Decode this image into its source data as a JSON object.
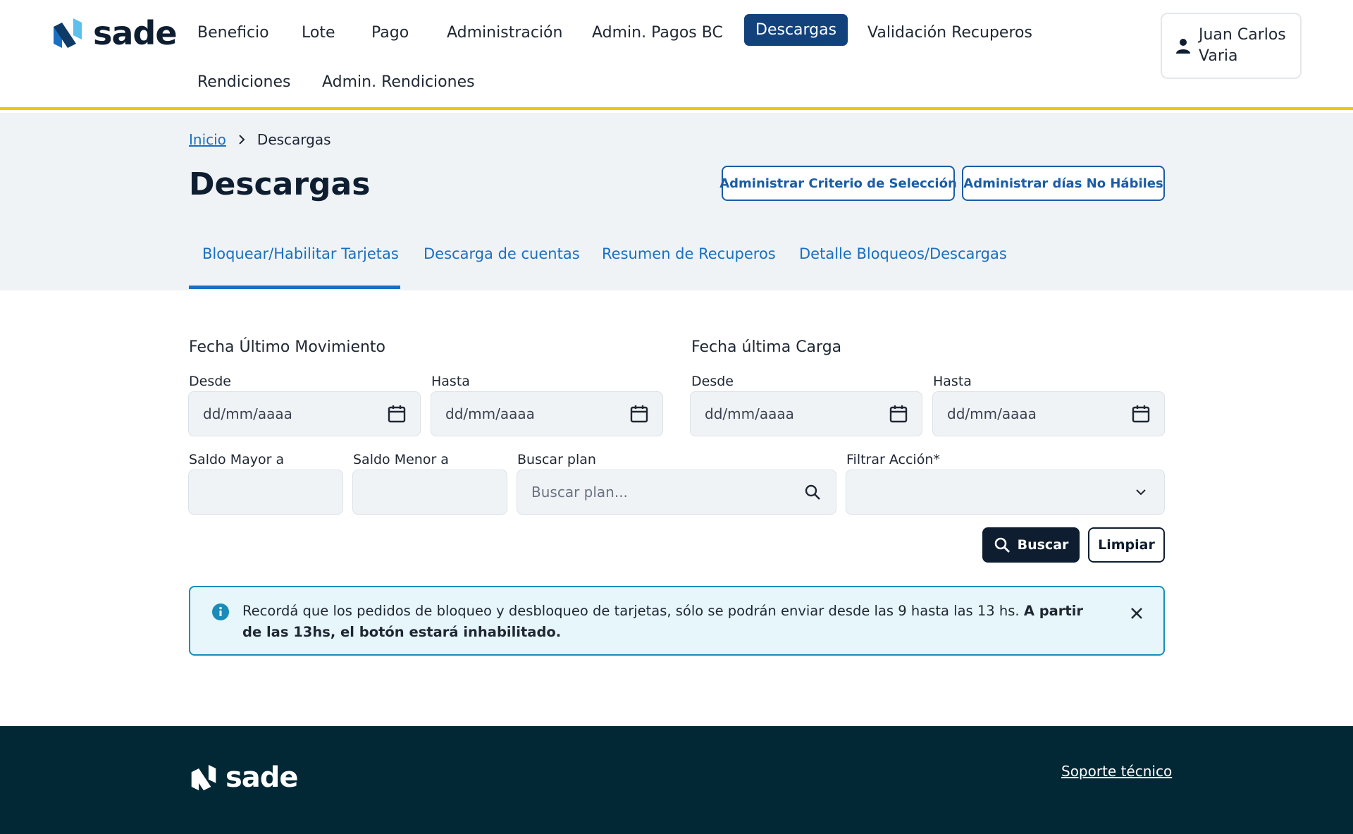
{
  "brand": {
    "name": "sade",
    "accent": "#f6c40c",
    "primary": "#12417b",
    "dark": "#0e1d30"
  },
  "nav": {
    "items": [
      "Beneficio",
      "Lote",
      "Pago",
      "Administración",
      "Admin. Pagos BC",
      "Descargas",
      "Validación Recuperos",
      "Rendiciones",
      "Admin. Rendiciones"
    ],
    "active": "Descargas"
  },
  "user": {
    "name": "Juan Carlos Varia",
    "icon": "person-icon"
  },
  "breadcrumb": {
    "home": "Inicio",
    "separator_icon": "chevron-right-icon",
    "current": "Descargas"
  },
  "page": {
    "title": "Descargas",
    "actions": [
      "Administrar Criterio de Selección",
      "Administrar días No Hábiles"
    ]
  },
  "tabs": {
    "items": [
      "Bloquear/Habilitar Tarjetas",
      "Descarga de cuentas",
      "Resumen de Recuperos",
      "Detalle Bloqueos/Descargas"
    ],
    "active": "Bloquear/Habilitar Tarjetas"
  },
  "form": {
    "ultimo_movimiento": {
      "title": "Fecha Último Movimiento",
      "desde_label": "Desde",
      "desde_placeholder": "dd/mm/aaaa",
      "hasta_label": "Hasta",
      "hasta_placeholder": "dd/mm/aaaa"
    },
    "ultima_carga": {
      "title": "Fecha última Carga",
      "desde_label": "Desde",
      "desde_placeholder": "dd/mm/aaaa",
      "hasta_label": "Hasta",
      "hasta_placeholder": "dd/mm/aaaa"
    },
    "saldo_mayor_label": "Saldo Mayor a",
    "saldo_mayor_value": "",
    "saldo_menor_label": "Saldo Menor a",
    "saldo_menor_value": "",
    "buscar_plan_label": "Buscar plan",
    "buscar_plan_placeholder": "Buscar plan...",
    "filtrar_accion_label": "Filtrar Acción*",
    "filtrar_accion_value": "",
    "search_button": "Buscar",
    "clear_button": "Limpiar"
  },
  "alert": {
    "icon": "info-icon",
    "text": "Recordá que los pedidos de bloqueo y desbloqueo de tarjetas, sólo se podrán enviar desde las 9 hasta las 13 hs.",
    "bold": "A partir de las 13hs, el botón estará inhabilitado."
  },
  "footer": {
    "logo": "sade",
    "link": "Soporte técnico"
  }
}
